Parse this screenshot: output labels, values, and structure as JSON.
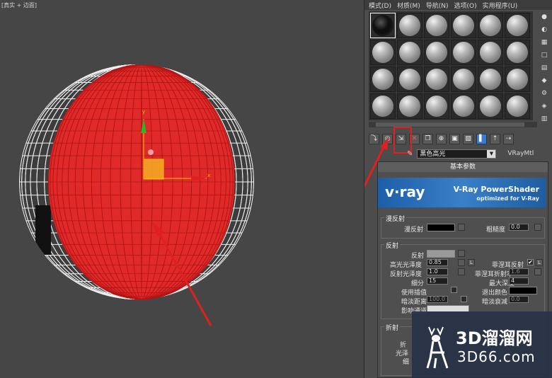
{
  "viewport": {
    "label": "[真实 + 边面]",
    "axis_x": "x",
    "axis_y": "y"
  },
  "menu": [
    "模式(D)",
    "材质(M)",
    "导航(N)",
    "选项(O)",
    "实用程序(U)"
  ],
  "material": {
    "name": "黑色高光",
    "type": "VRayMtl",
    "rollout_title": "基本参数"
  },
  "vray_banner": {
    "logo": "v·ray",
    "title": "V-Ray PowerShader",
    "subtitle": "optimized for V-Ray"
  },
  "diffuse": {
    "section": "漫反射",
    "diffuse_label": "漫反射",
    "roughness_label": "粗糙度",
    "roughness_value": "0.0"
  },
  "reflection": {
    "section": "反射",
    "reflect_label": "反射",
    "hilight_gloss_label": "高光光泽度",
    "hilight_gloss_value": "0.85",
    "refl_gloss_label": "反射光泽度",
    "refl_gloss_value": "1.0",
    "subdivs_label": "细分",
    "subdivs_value": "15",
    "use_interp_label": "使用插值",
    "dim_dist_label": "暗淡距离",
    "dim_dist_value": "100.0",
    "affect_label": "影响通道",
    "fresnel_label": "菲涅耳反射",
    "fresnel_ior_label": "菲涅耳折射率",
    "fresnel_ior_value": "1.6",
    "max_depth_label": "最大深度",
    "max_depth_value": "4",
    "exit_color_label": "退出颜色",
    "dim_falloff_label": "暗淡衰减",
    "dim_falloff_value": "0.0",
    "l_label": "L"
  },
  "refraction": {
    "section": "折射",
    "frag1": "折",
    "frag2": "光泽",
    "frag3": "细"
  },
  "watermark": {
    "brand": "3D溜溜网",
    "url": "3D66.com"
  },
  "colors": {
    "sphere_red": "#e02a2a",
    "arrow_red": "#e02020",
    "vray_blue": "#2a6cb8"
  },
  "icons": [
    "pick-material-icon",
    "put-to-scene-icon",
    "assign-material-icon",
    "delete-icon",
    "copy-icon",
    "unique-icon",
    "material-effects-icon",
    "show-map-icon",
    "show-result-icon",
    "go-parent-icon",
    "go-sibling-icon"
  ]
}
